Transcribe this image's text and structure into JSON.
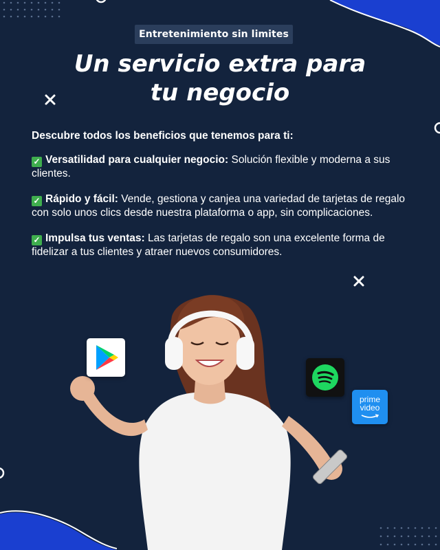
{
  "tag": "Entretenimiento sin limites",
  "headline": {
    "line1": "Un servicio extra para",
    "line2": "tu negocio"
  },
  "intro": "Descubre todos los beneficios que tenemos para ti:",
  "benefits": [
    {
      "title": "Versatilidad para cualquier negocio:",
      "text": "Solución flexible y moderna a sus clientes."
    },
    {
      "title": "Rápido y fácil:",
      "text": "Vende, gestiona y canjea una variedad de tarjetas de regalo con solo unos clics desde nuestra plataforma o app, sin complicaciones."
    },
    {
      "title": "Impulsa tus ventas:",
      "text": "Las tarjetas de regalo son una excelente forma de fidelizar a tus clientes y atraer nuevos consumidores."
    }
  ],
  "check_symbol": "✓",
  "apps": {
    "prime_line1": "prime",
    "prime_line2": "video",
    "icons": [
      "google-play-icon",
      "spotify-icon",
      "prime-video-icon"
    ]
  },
  "colors": {
    "background": "#13233d",
    "accent_blue": "#1236b8",
    "tag_bg": "#2b3e5c",
    "check_green": "#3fae4e"
  }
}
